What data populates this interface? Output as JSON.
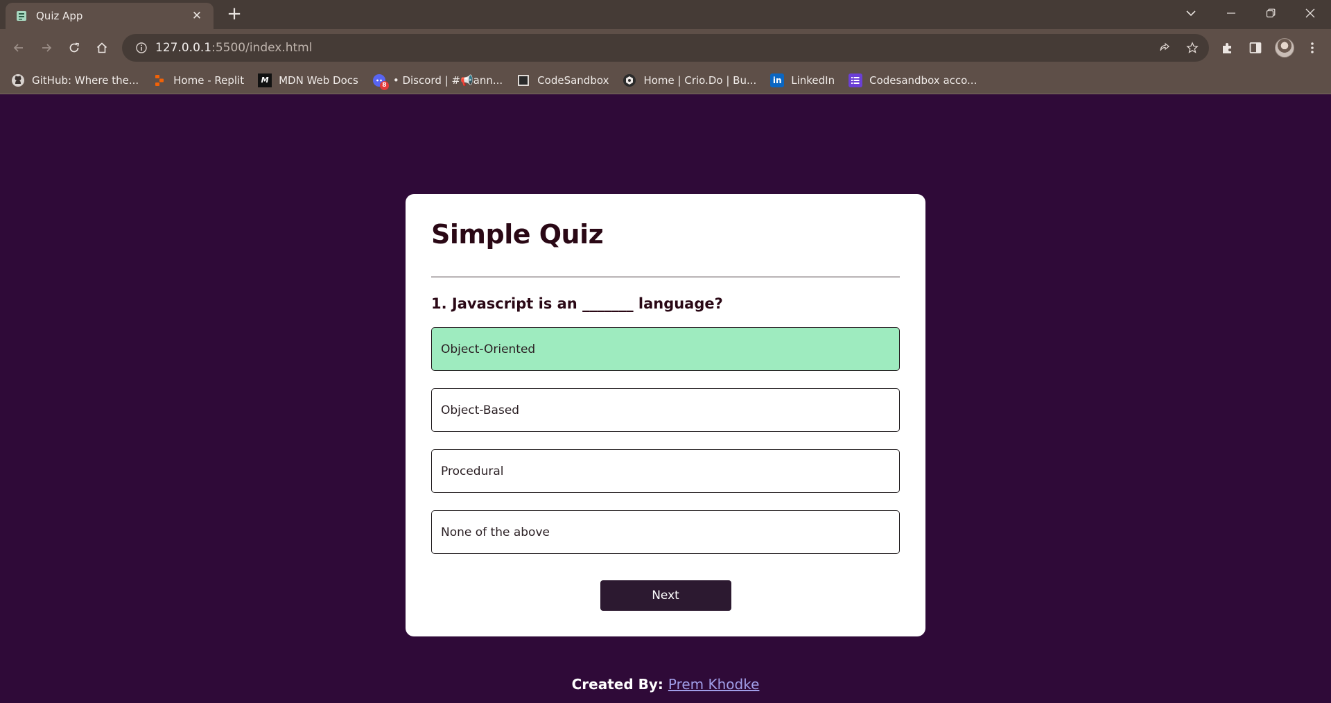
{
  "browser": {
    "tab_title": "Quiz App",
    "tab_close": "✕",
    "new_tab": "+",
    "url_host": "127.0.0.1",
    "url_path": ":5500/index.html",
    "bookmarks": [
      {
        "label": "GitHub: Where the...",
        "icon": "github-icon"
      },
      {
        "label": "Home - Replit",
        "icon": "replit-icon"
      },
      {
        "label": "MDN Web Docs",
        "icon": "mdn-icon"
      },
      {
        "label": "• Discord | #📢ann...",
        "icon": "discord-icon",
        "badge": "8"
      },
      {
        "label": "CodeSandbox",
        "icon": "codesandbox-icon"
      },
      {
        "label": "Home | Crio.Do | Bu...",
        "icon": "crio-icon"
      },
      {
        "label": "LinkedIn",
        "icon": "linkedin-icon"
      },
      {
        "label": "Codesandbox acco...",
        "icon": "list-icon"
      }
    ]
  },
  "quiz": {
    "title": "Simple Quiz",
    "question": "1. Javascript is an _______ language?",
    "answers": [
      {
        "label": "Object-Oriented",
        "selected": true
      },
      {
        "label": "Object-Based",
        "selected": false
      },
      {
        "label": "Procedural",
        "selected": false
      },
      {
        "label": "None of the above",
        "selected": false
      }
    ],
    "next_label": "Next"
  },
  "footer": {
    "prefix": "Created By:",
    "author": "Prem Khodke"
  },
  "colors": {
    "page_bg": "#2f0a38",
    "selected_answer": "#9eebbf",
    "next_button": "#2c1930",
    "author_link": "#a19ee8"
  }
}
